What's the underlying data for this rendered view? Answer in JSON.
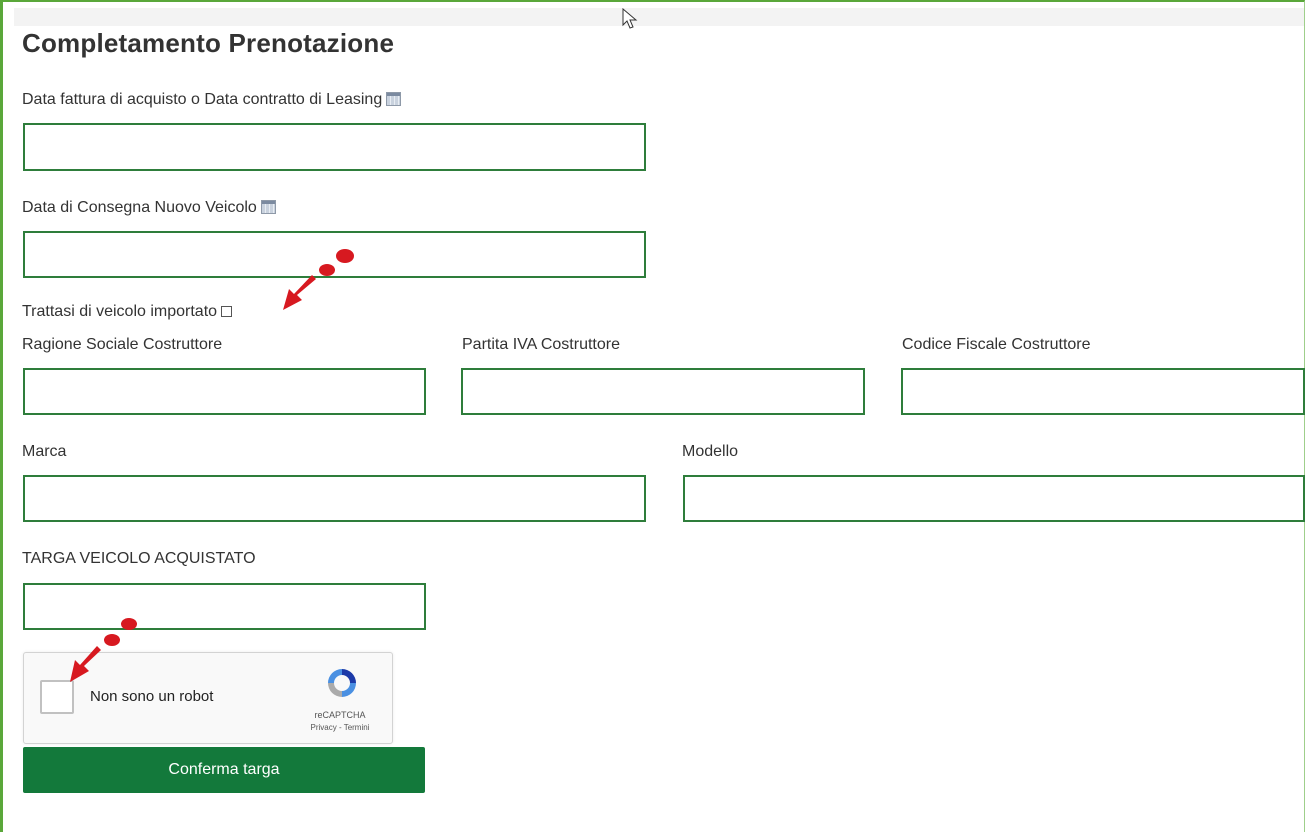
{
  "form": {
    "title": "Completamento Prenotazione",
    "invoice_date_label": "Data fattura di acquisto o Data contratto di Leasing",
    "delivery_date_label": "Data di Consegna Nuovo Veicolo",
    "imported_label": "Trattasi di veicolo importato",
    "manufacturer_name_label": "Ragione Sociale Costruttore",
    "manufacturer_vat_label": "Partita IVA Costruttore",
    "manufacturer_tax_code_label": "Codice Fiscale Costruttore",
    "brand_label": "Marca",
    "model_label": "Modello",
    "plate_label": "TARGA VEICOLO ACQUISTATO",
    "invoice_date_value": "",
    "delivery_date_value": "",
    "manufacturer_name_value": "",
    "manufacturer_vat_value": "",
    "manufacturer_tax_code_value": "",
    "brand_value": "",
    "model_value": "",
    "plate_value": "",
    "imported_checked": false
  },
  "captcha": {
    "label": "Non sono un robot",
    "brand": "reCAPTCHA",
    "links": "Privacy - Termini",
    "checked": false
  },
  "submit": {
    "label": "Conferma targa"
  },
  "colors": {
    "accent_green": "#13793b",
    "field_border": "#2e7d3b",
    "frame_border": "#5aa73a",
    "annotation_red": "#d71920"
  },
  "icons": [
    "calendar-icon",
    "checkbox",
    "recaptcha-logo-icon",
    "red-arrow-annotation-icon",
    "mouse-cursor-icon"
  ]
}
